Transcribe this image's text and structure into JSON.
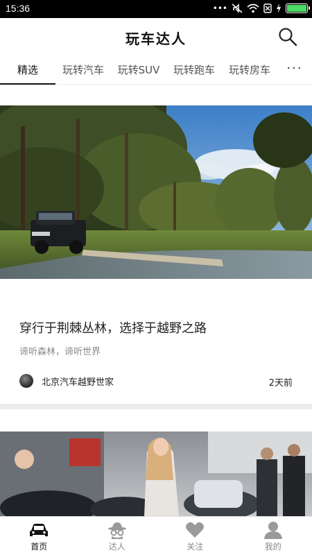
{
  "status": {
    "time": "15:36",
    "battery_level": 1.0,
    "battery_color": "#4cd964"
  },
  "header": {
    "title": "玩车达人",
    "search_icon": "search-icon"
  },
  "tabs": [
    {
      "label": "精选",
      "active": true
    },
    {
      "label": "玩转汽车",
      "active": false
    },
    {
      "label": "玩转SUV",
      "active": false
    },
    {
      "label": "玩转跑车",
      "active": false
    },
    {
      "label": "玩转房车",
      "active": false
    }
  ],
  "more_label": "···",
  "articles": [
    {
      "title": "穿行于荆棘丛林，选择于越野之路",
      "subtitle": "谛听森林，谛听世界",
      "author": "北京汽车越野世家",
      "time": "2天前",
      "image": "forest-suv-photo"
    },
    {
      "image": "auto-show-photo"
    }
  ],
  "bottom_nav": [
    {
      "label": "首页",
      "icon": "car-icon",
      "active": true
    },
    {
      "label": "达人",
      "icon": "spy-hat-icon",
      "active": false
    },
    {
      "label": "关注",
      "icon": "heart-icon",
      "active": false
    },
    {
      "label": "我的",
      "icon": "user-icon",
      "active": false
    }
  ],
  "colors": {
    "accent": "#111111",
    "inactive": "#888888"
  }
}
